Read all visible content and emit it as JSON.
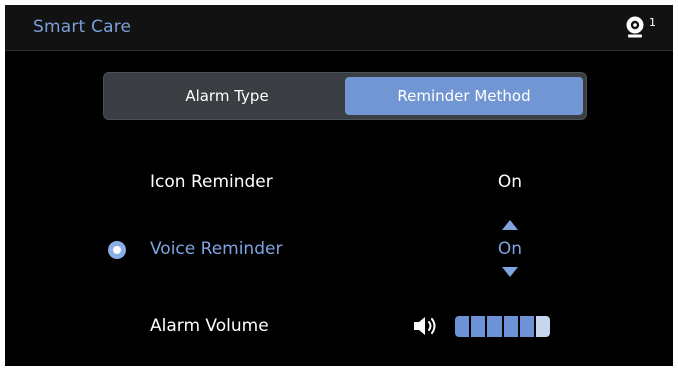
{
  "header": {
    "title": "Smart Care",
    "status_icon": "camera-icon",
    "status_count": "1"
  },
  "tabs": [
    {
      "label": "Alarm Type",
      "selected": false
    },
    {
      "label": "Reminder Method",
      "selected": true
    }
  ],
  "settings": [
    {
      "label": "Icon Reminder",
      "value": "On",
      "selected": false
    },
    {
      "label": "Voice Reminder",
      "value": "On",
      "selected": true
    },
    {
      "label": "Alarm Volume",
      "icon": "speaker-icon",
      "volume_level": 5,
      "volume_max": 6
    }
  ],
  "colors": {
    "accent": "#7196d3",
    "highlight_text": "#7fa4e0",
    "title_text": "#7a9fda",
    "volume_on": "#6d93d6",
    "volume_off": "#c8d5ee",
    "background": "#000000"
  }
}
